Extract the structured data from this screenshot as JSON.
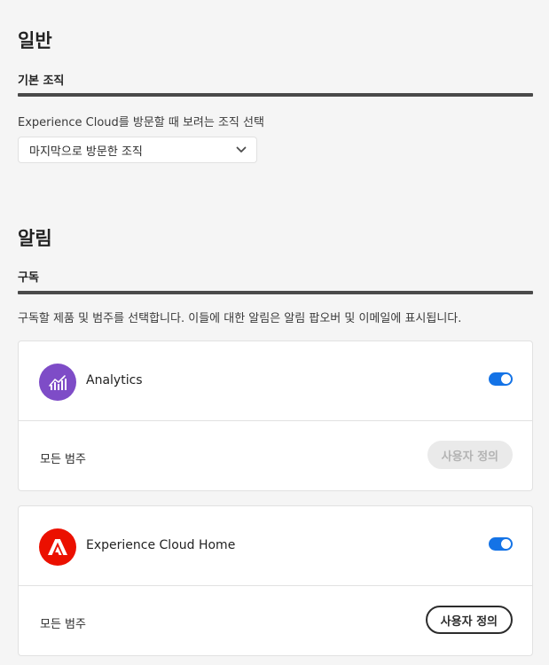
{
  "general": {
    "title": "일반",
    "default_org": {
      "heading": "기본 조직",
      "description": "Experience Cloud를 방문할 때 보려는 조직 선택",
      "picker_value": "마지막으로 방문한 조직"
    }
  },
  "notifications": {
    "title": "알림",
    "subscriptions": {
      "heading": "구독",
      "description": "구독할 제품 및 범주를 선택합니다. 이들에 대한 알림은 알림 팝오버 및 이메일에 표시됩니다.",
      "products": [
        {
          "name": "Analytics",
          "icon": "analytics-icon",
          "icon_color": "#7e4cc7",
          "enabled": true,
          "category_label": "모든 범주",
          "customize_label": "사용자 정의",
          "customize_enabled": false
        },
        {
          "name": "Experience Cloud Home",
          "icon": "adobe-icon",
          "icon_color": "#eb1000",
          "enabled": true,
          "category_label": "모든 범주",
          "customize_label": "사용자 정의",
          "customize_enabled": true
        }
      ]
    }
  },
  "colors": {
    "accent": "#1473e6",
    "rule": "#4a4a4a"
  }
}
